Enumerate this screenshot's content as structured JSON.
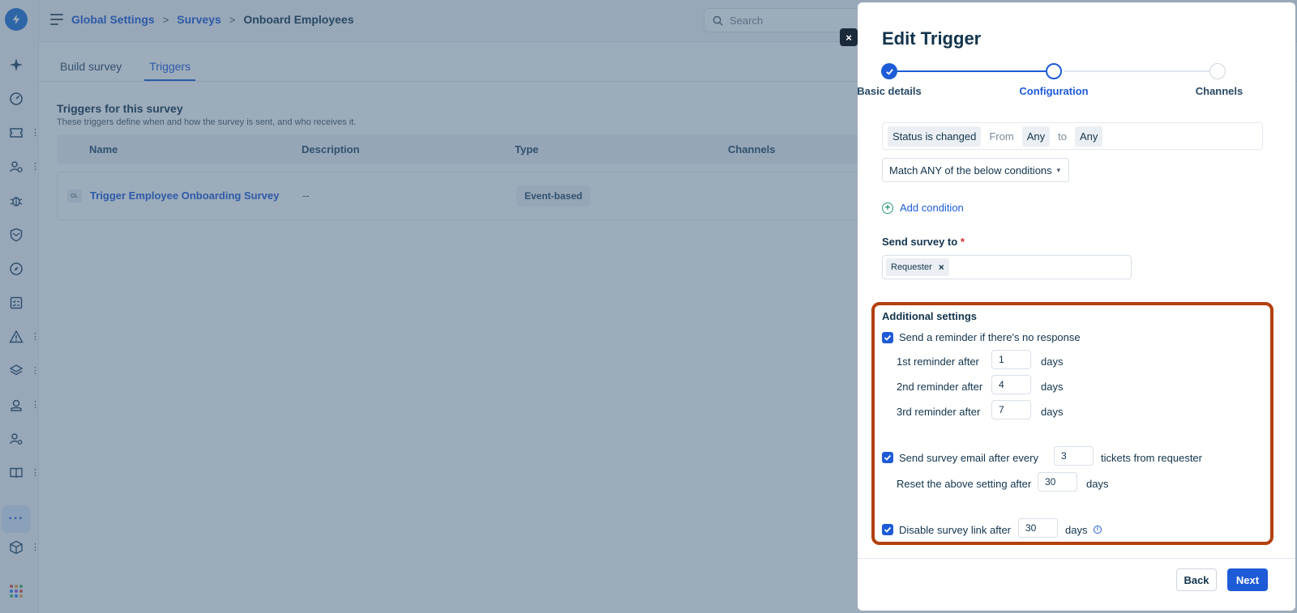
{
  "app": {
    "logo_icon": "freshservice-bolt-icon"
  },
  "breadcrumb": {
    "items": [
      "Global Settings",
      "Surveys"
    ],
    "current": "Onboard Employees",
    "separator": ">"
  },
  "search": {
    "placeholder": "Search"
  },
  "rail": {
    "icons": [
      "sparkle-icon",
      "dashboard-icon",
      "ticket-icon",
      "users-icon",
      "bug-icon",
      "shield-icon",
      "compass-icon",
      "checklist-icon",
      "alert-icon",
      "layers-icon",
      "contact-icon",
      "person-gear-icon",
      "book-icon",
      "more-icon",
      "box-icon",
      "apps-grid-icon"
    ],
    "more_label": "···"
  },
  "tabs": [
    {
      "label": "Build survey",
      "active": false
    },
    {
      "label": "Triggers",
      "active": true
    }
  ],
  "triggers_section": {
    "title": "Triggers for this survey",
    "subtitle": "These triggers define when and how the survey is sent, and who receives it.",
    "columns": [
      "Name",
      "Description",
      "Type",
      "Channels"
    ],
    "rows": [
      {
        "badge": "GL",
        "name": "Trigger Employee Onboarding Survey",
        "description": "--",
        "type": "Event-based"
      }
    ]
  },
  "drawer": {
    "close_label": "×",
    "title": "Edit Trigger",
    "steps": [
      {
        "label": "Basic details",
        "state": "done"
      },
      {
        "label": "Configuration",
        "state": "current"
      },
      {
        "label": "Channels",
        "state": "todo"
      }
    ],
    "condition": {
      "event": "Status is changed",
      "from_label": "From",
      "from_value": "Any",
      "to_label": "to",
      "to_value": "Any"
    },
    "match_select": {
      "value": "Match ANY of the below conditions"
    },
    "add_condition_label": "Add condition",
    "send_to": {
      "label": "Send survey to",
      "required_mark": "*",
      "tags": [
        "Requester"
      ]
    },
    "additional_settings": {
      "title": "Additional settings",
      "reminder": {
        "label": "Send a reminder if there's no response",
        "checked": true,
        "items": [
          {
            "label": "1st reminder after",
            "value": "1",
            "unit": "days"
          },
          {
            "label": "2nd reminder after",
            "value": "4",
            "unit": "days"
          },
          {
            "label": "3rd reminder after",
            "value": "7",
            "unit": "days"
          }
        ]
      },
      "frequency": {
        "label": "Send survey email after every",
        "checked": true,
        "value": "3",
        "suffix": "tickets from requester",
        "reset_label": "Reset the above setting after",
        "reset_value": "30",
        "reset_unit": "days"
      },
      "disable_link": {
        "label": "Disable survey link after",
        "checked": true,
        "value": "30",
        "unit": "days"
      }
    },
    "footer": {
      "back_label": "Back",
      "next_label": "Next"
    }
  },
  "colors": {
    "primary": "#1e5bd7",
    "highlight_border": "#b3400e",
    "overlay": "rgba(60,90,120,0.5)"
  }
}
